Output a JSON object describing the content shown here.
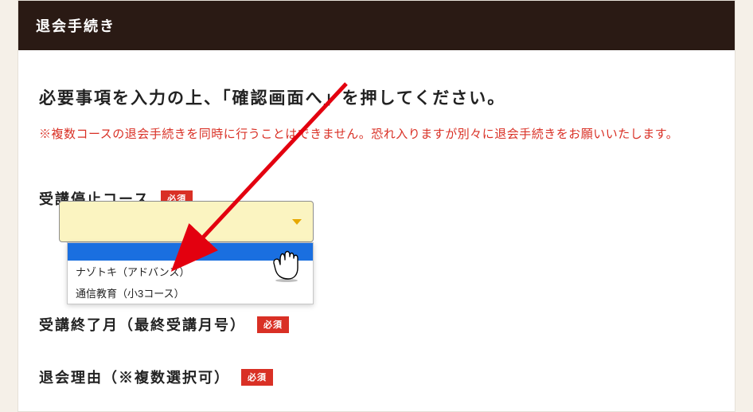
{
  "header": {
    "title": "退会手続き"
  },
  "instruction": "必要事項を入力の上、「確認画面へ」を押してください。",
  "warning": "※複数コースの退会手続きを同時に行うことはできません。恐れ入りますが別々に退会手続きをお願いいたします。",
  "badges": {
    "required": "必須"
  },
  "fields": {
    "course_stop": {
      "label": "受講停止コース"
    },
    "end_month": {
      "label": "受講終了月（最終受講月号）"
    },
    "reason": {
      "label": "退会理由（※複数選択可）"
    }
  },
  "dropdown": {
    "selected": "",
    "options": [
      {
        "label": "",
        "highlighted": true
      },
      {
        "label": "ナゾトキ（アドバンス）",
        "highlighted": false
      },
      {
        "label": "通信教育（小3コース）",
        "highlighted": false
      }
    ]
  }
}
